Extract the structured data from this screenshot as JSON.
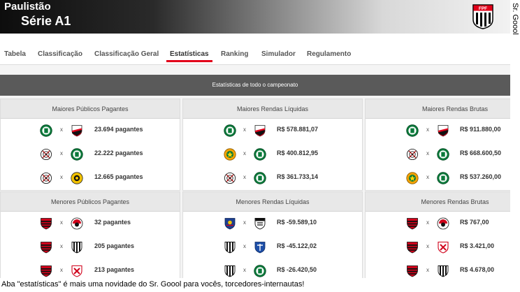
{
  "header": {
    "title_line1": "Paulistão",
    "title_line2": "Série A1"
  },
  "credit": "Sr. Goool",
  "tabs": [
    {
      "label": "Tabela"
    },
    {
      "label": "Classificação"
    },
    {
      "label": "Classificação Geral"
    },
    {
      "label": "Estatísticas",
      "active": true
    },
    {
      "label": "Ranking"
    },
    {
      "label": "Simulador"
    },
    {
      "label": "Regulamento"
    }
  ],
  "section_title": "Estatísticas de todo o campeonato",
  "cards": [
    {
      "title": "Maiores Públicos Pagantes",
      "rows": [
        {
          "home": "palmeiras-crest-icon",
          "away": "sao-paulo-crest-icon",
          "value": "23.694 pagantes"
        },
        {
          "home": "corinthians-crest-icon",
          "away": "palmeiras-crest-icon",
          "value": "22.222 pagantes"
        },
        {
          "home": "corinthians-crest-icon",
          "away": "novorizontino-crest-icon",
          "value": "12.665 pagantes"
        }
      ]
    },
    {
      "title": "Maiores Rendas Líquidas",
      "rows": [
        {
          "home": "palmeiras-crest-icon",
          "away": "sao-paulo-crest-icon",
          "value": "R$ 578.881,07"
        },
        {
          "home": "mirassol-crest-icon",
          "away": "palmeiras-crest-icon",
          "value": "R$ 400.812,95"
        },
        {
          "home": "corinthians-crest-icon",
          "away": "palmeiras-crest-icon",
          "value": "R$ 361.733,14"
        }
      ]
    },
    {
      "title": "Maiores Rendas Brutas",
      "rows": [
        {
          "home": "palmeiras-crest-icon",
          "away": "sao-paulo-crest-icon",
          "value": "R$ 911.880,00"
        },
        {
          "home": "corinthians-crest-icon",
          "away": "palmeiras-crest-icon",
          "value": "R$ 668.600,50"
        },
        {
          "home": "mirassol-crest-icon",
          "away": "palmeiras-crest-icon",
          "value": "R$ 537.260,00"
        }
      ]
    },
    {
      "title": "Menores Públicos Pagantes",
      "rows": [
        {
          "home": "flamengo-crest-icon",
          "away": "ituano-crest-icon",
          "value": "32 pagantes"
        },
        {
          "home": "flamengo-crest-icon",
          "away": "botafogo-crest-icon",
          "value": "205 pagantes"
        },
        {
          "home": "flamengo-crest-icon",
          "away": "linense-crest-icon",
          "value": "213 pagantes"
        }
      ]
    },
    {
      "title": "Menores Rendas Líquidas",
      "rows": [
        {
          "home": "red-bull-crest-icon",
          "away": "santos-crest-icon",
          "value": "R$ -59.589,10"
        },
        {
          "home": "botafogo-crest-icon",
          "away": "sao-bento-crest-icon",
          "value": "R$ -45.122,02"
        },
        {
          "home": "botafogo-crest-icon",
          "away": "palmeiras-crest-icon",
          "value": "R$ -26.420,50"
        }
      ]
    },
    {
      "title": "Menores Rendas Brutas",
      "rows": [
        {
          "home": "flamengo-crest-icon",
          "away": "ituano-crest-icon",
          "value": "R$ 767,00"
        },
        {
          "home": "flamengo-crest-icon",
          "away": "linense-crest-icon",
          "value": "R$ 3.421,00"
        },
        {
          "home": "flamengo-crest-icon",
          "away": "botafogo-crest-icon",
          "value": "R$ 4.678,00"
        }
      ]
    }
  ],
  "vs_label": "x",
  "caption": "Aba \"estatísticas\" é mais uma novidade do Sr. Goool para vocês, torcedores-internautas!",
  "colors": {
    "accent": "#e2001a",
    "section_bar": "#5a5a5a",
    "card_header": "#e8e8e8"
  }
}
